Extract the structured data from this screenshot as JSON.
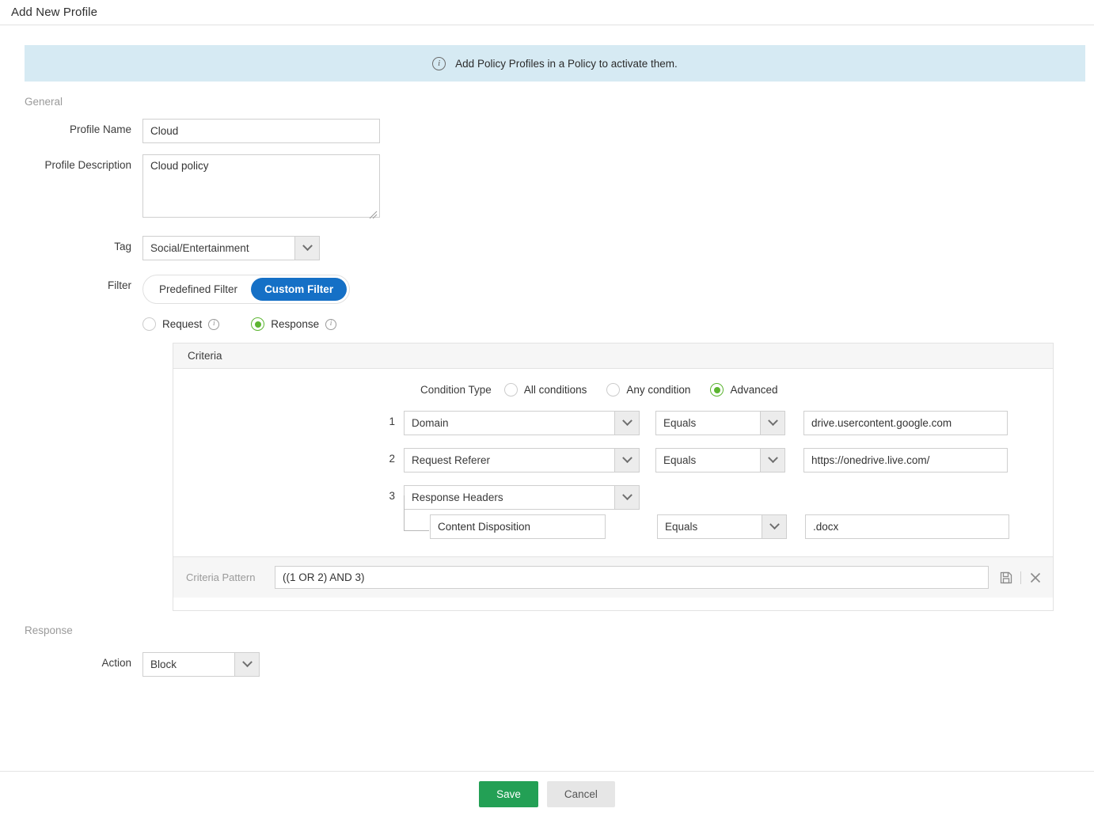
{
  "header": {
    "title": "Add New Profile"
  },
  "banner": {
    "icon": "info-icon",
    "message": "Add Policy Profiles in a Policy to activate them."
  },
  "general": {
    "section_label": "General",
    "profile_name": {
      "label": "Profile Name",
      "value": "Cloud",
      "placeholder": ""
    },
    "profile_description": {
      "label": "Profile Description",
      "value": "Cloud policy",
      "placeholder": ""
    },
    "tag": {
      "label": "Tag",
      "value": "Social/Entertainment"
    },
    "filter": {
      "label": "Filter",
      "options": [
        "Predefined Filter",
        "Custom Filter"
      ],
      "predefined_label": "Predefined Filter",
      "custom_label": "Custom Filter",
      "selected": "Custom Filter"
    },
    "direction": {
      "request_label": "Request",
      "response_label": "Response",
      "selected": "Response"
    }
  },
  "criteria": {
    "panel_title": "Criteria",
    "condition_type": {
      "label": "Condition Type",
      "options": [
        "All conditions",
        "Any condition",
        "Advanced"
      ],
      "all_label": "All conditions",
      "any_label": "Any condition",
      "advanced_label": "Advanced",
      "selected": "Advanced"
    },
    "rows": [
      {
        "num": "1",
        "field": "Domain",
        "operator": "Equals",
        "value": "drive.usercontent.google.com"
      },
      {
        "num": "2",
        "field": "Request Referer",
        "operator": "Equals",
        "value": "https://onedrive.live.com/"
      },
      {
        "num": "3",
        "field": "Response Headers",
        "operator": "",
        "value": ""
      }
    ],
    "sub_row": {
      "name": "Content Disposition",
      "operator": "Equals",
      "value": ".docx"
    },
    "pattern": {
      "label": "Criteria Pattern",
      "value": "((1 OR 2) AND 3)",
      "save_icon": "save-disk-icon",
      "close_icon": "close-x-icon"
    }
  },
  "response": {
    "section_label": "Response",
    "action": {
      "label": "Action",
      "value": "Block"
    }
  },
  "footer": {
    "save_label": "Save",
    "cancel_label": "Cancel"
  },
  "colors": {
    "accent_blue": "#1570c6",
    "accent_green": "#5cb531",
    "save_green": "#23a055",
    "banner_blue": "#d6eaf3"
  }
}
